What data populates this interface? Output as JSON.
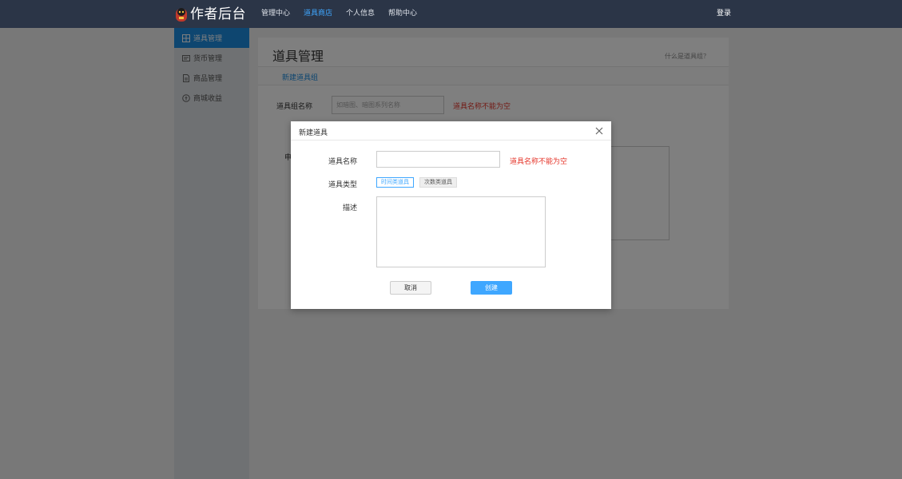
{
  "brand": {
    "title": "作者后台"
  },
  "nav": {
    "items": [
      {
        "label": "管理中心"
      },
      {
        "label": "道具商店"
      },
      {
        "label": "个人信息"
      },
      {
        "label": "帮助中心"
      }
    ],
    "active_index": 1,
    "login_label": "登录"
  },
  "sidebar": {
    "items": [
      {
        "label": "道具管理",
        "icon": "grid-icon",
        "active": true
      },
      {
        "label": "货币管理",
        "icon": "card-icon",
        "active": false
      },
      {
        "label": "商品管理",
        "icon": "document-icon",
        "active": false
      },
      {
        "label": "商城收益",
        "icon": "coin-icon",
        "active": false
      }
    ]
  },
  "main": {
    "title": "道具管理",
    "help_link": "什么是道具组？",
    "tab_label": "新建道具组",
    "group_name_label": "道具组名称",
    "group_name_placeholder": "如暗图、暗图系列名称",
    "group_name_error": "道具名称不能为空",
    "partial_label_1": "申"
  },
  "dialog": {
    "title": "新建道具",
    "name_label": "道具名称",
    "name_value": "",
    "name_error": "道具名称不能为空",
    "type_label": "道具类型",
    "type_options": [
      "时间类道具",
      "次数类道具"
    ],
    "type_selected_index": 0,
    "desc_label": "描述",
    "desc_value": "",
    "cancel_label": "取消",
    "create_label": "创建"
  },
  "colors": {
    "topbar": "#2b3547",
    "accent": "#3fa7ff",
    "sidebar_active": "#1d8ce0",
    "error": "#e5352a",
    "overlay": "rgba(0,0,0,0.5)"
  }
}
